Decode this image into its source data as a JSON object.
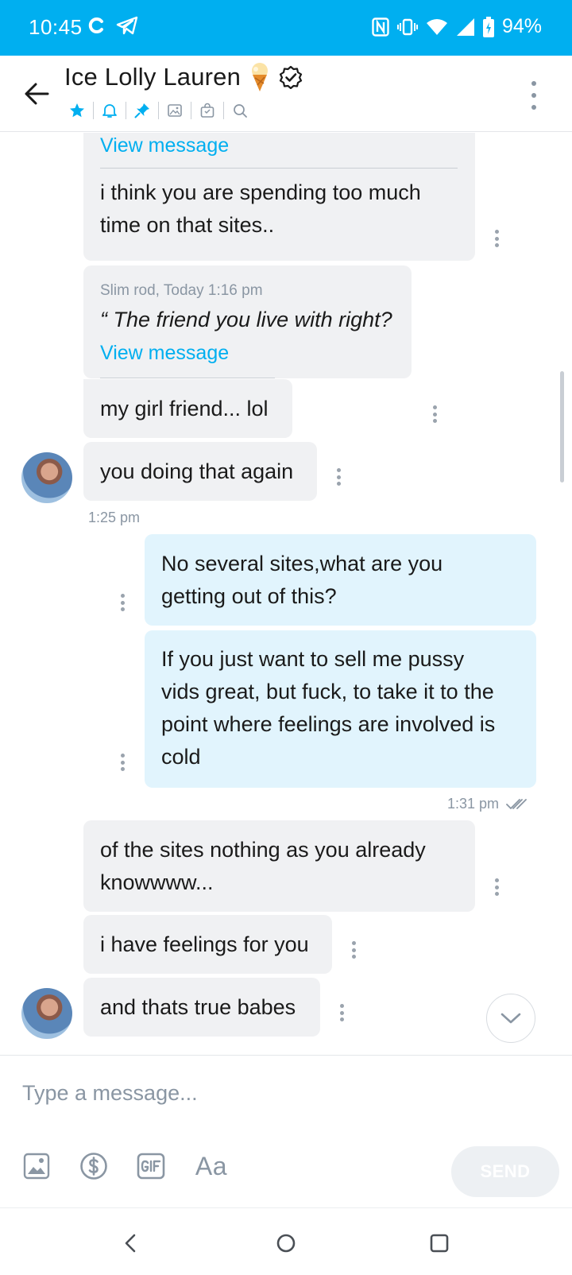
{
  "status_bar": {
    "time": "10:45",
    "battery": "94%"
  },
  "header": {
    "title": "Ice Lolly Lauren",
    "title_emoji": "ice-cream-cone",
    "icons": [
      "star-icon",
      "bell-icon",
      "pin-icon",
      "image-icon",
      "bag-icon",
      "search-icon"
    ]
  },
  "messages": {
    "m1_view_link": "View message",
    "m1_text_1": "i think you are spending too much",
    "m1_text_2": "time on that sites..",
    "m2_quote_meta": "Slim rod, Today 1:16 pm",
    "m2_quote_text": "“ The friend you live with right?",
    "m2_view_link": "View message",
    "m2_text": "my girl friend... lol",
    "m3_text": "you doing that again",
    "time_1": "1:25 pm",
    "m4_text_1": "No several sites,what are you",
    "m4_text_2": "getting out of this?",
    "m5_text_1": "If you just want to sell me pussy",
    "m5_text_2": "vids great, but fuck, to take it to the",
    "m5_text_3": "point where feelings are involved is",
    "m5_text_4": "cold",
    "time_2": "1:31 pm",
    "m6_text_1": "of the sites nothing as you already",
    "m6_text_2": "knowwww...",
    "m7_text": "i have feelings for you",
    "m8_text": "and thats true babes"
  },
  "composer": {
    "placeholder": "Type a message...",
    "send_label": "SEND",
    "text_tool_label": "Aa"
  },
  "colors": {
    "accent": "#00aff0",
    "incoming_bubble": "#f0f1f3",
    "outgoing_bubble": "#e1f4fd",
    "muted_text": "#8a96a3"
  }
}
